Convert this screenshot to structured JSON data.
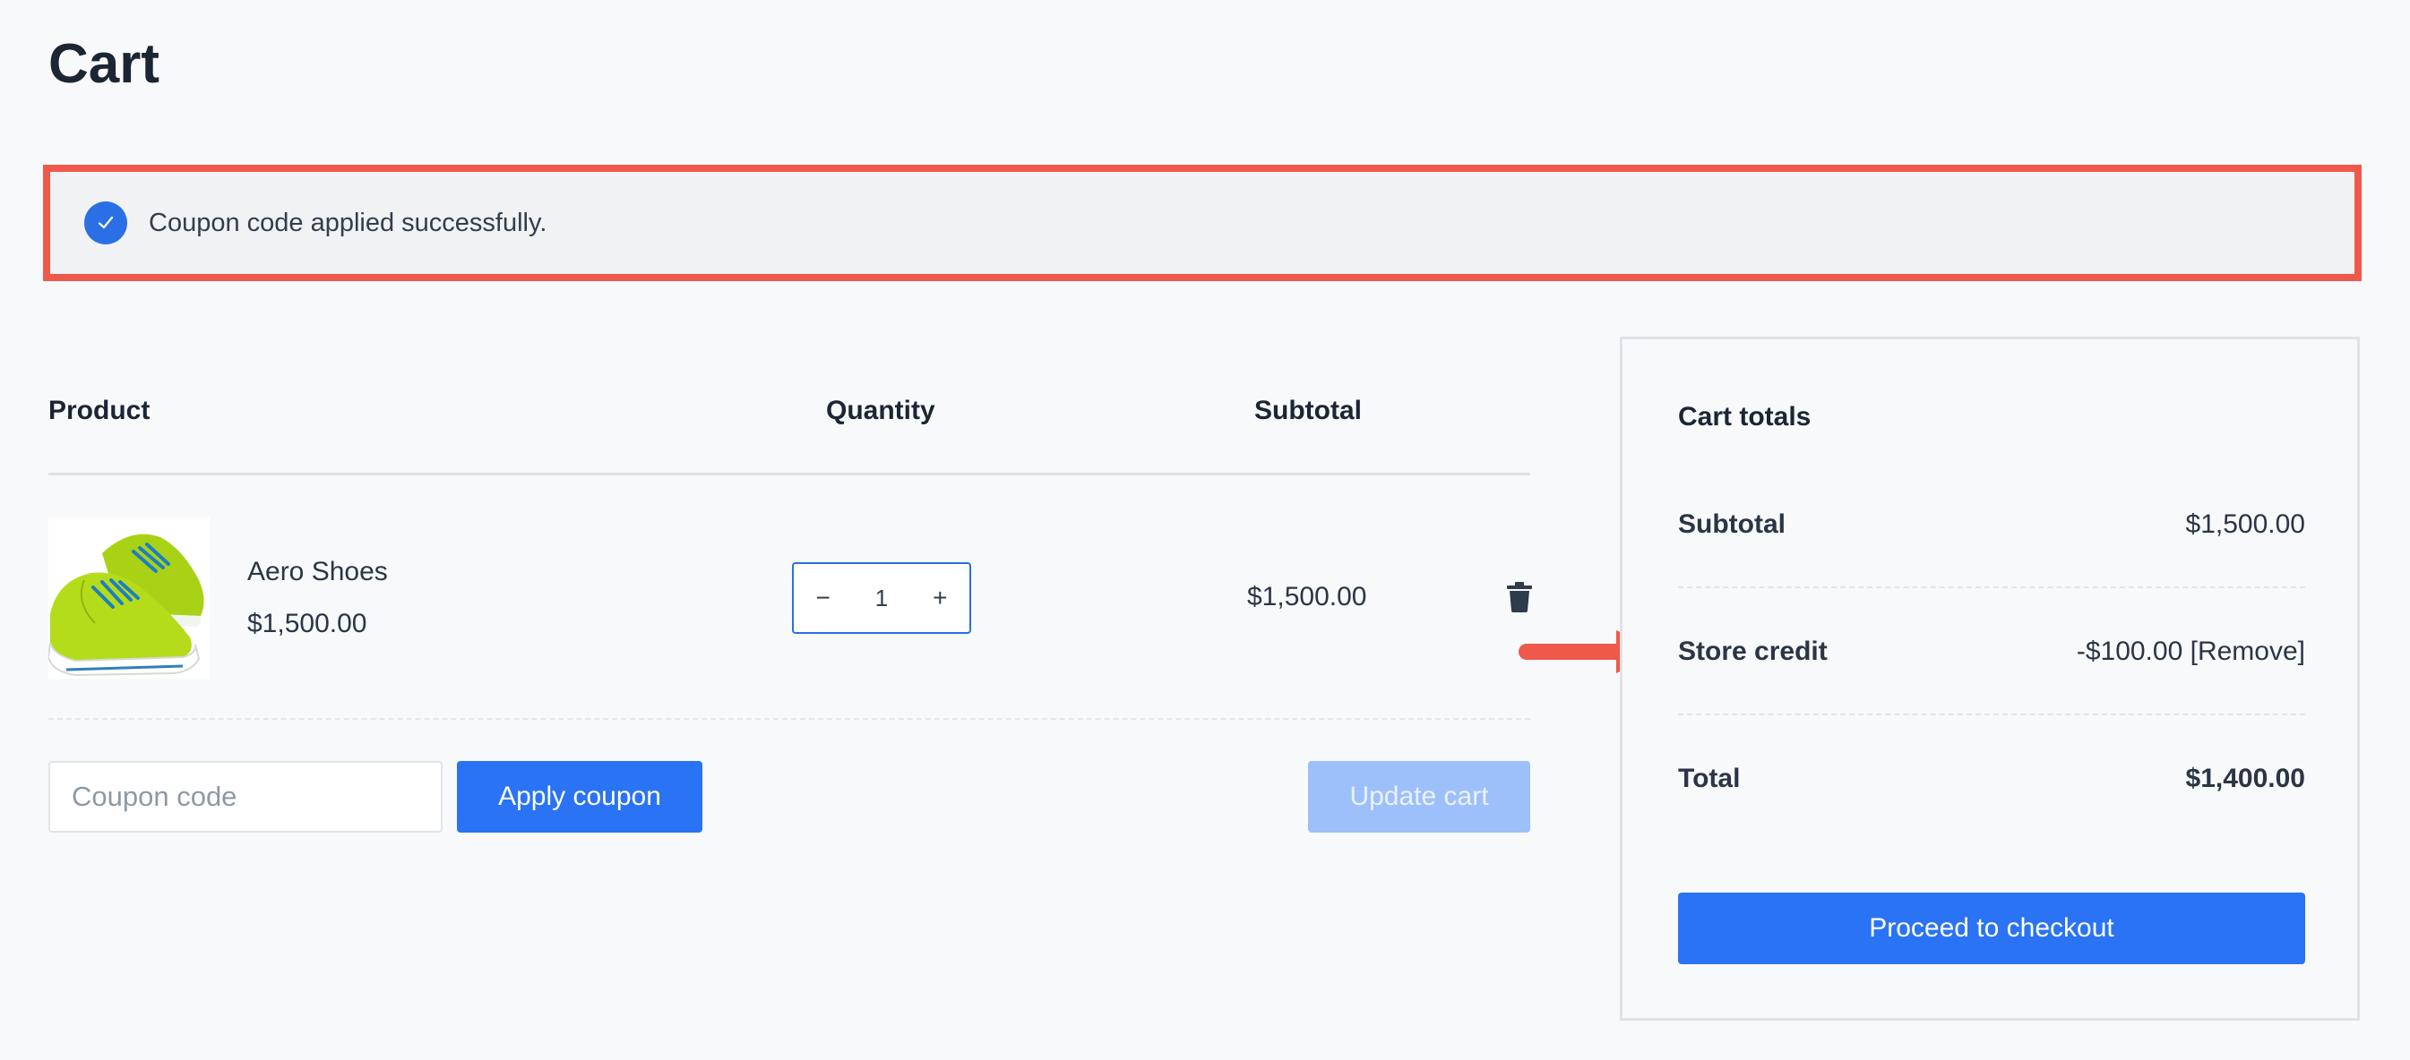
{
  "page": {
    "title": "Cart"
  },
  "notice": {
    "text": "Coupon code applied successfully.",
    "icon": "check-circle-icon"
  },
  "table": {
    "headers": {
      "product": "Product",
      "quantity": "Quantity",
      "subtotal": "Subtotal"
    },
    "items": [
      {
        "name": "Aero Shoes",
        "price": "$1,500.00",
        "quantity": "1",
        "subtotal": "$1,500.00",
        "image": "green-sneakers"
      }
    ]
  },
  "coupon": {
    "placeholder": "Coupon code",
    "apply_label": "Apply coupon"
  },
  "update_label": "Update cart",
  "totals": {
    "title": "Cart totals",
    "subtotal_label": "Subtotal",
    "subtotal_value": "$1,500.00",
    "credit_label": "Store credit",
    "credit_value": "-$100.00",
    "remove_label": "[Remove]",
    "total_label": "Total",
    "total_value": "$1,400.00",
    "checkout_label": "Proceed to checkout"
  },
  "colors": {
    "accent": "#2a73f4",
    "highlight": "#f0584b",
    "disabled": "#9dc0fb"
  }
}
